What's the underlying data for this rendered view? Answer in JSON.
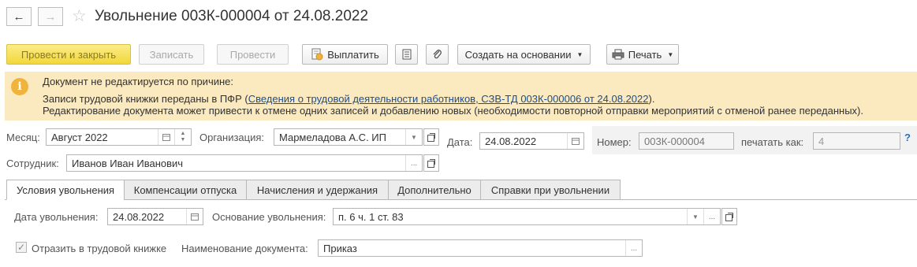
{
  "window": {
    "title": "Увольнение 003К-000004 от 24.08.2022",
    "back_glyph": "←",
    "forward_glyph": "→",
    "star_glyph": "☆"
  },
  "toolbar": {
    "post_close": "Провести и закрыть",
    "save": "Записать",
    "post": "Провести",
    "pay": "Выплатить",
    "create_basis": "Создать на основании",
    "print": "Печать",
    "caret": "▼"
  },
  "banner": {
    "icon_glyph": "i",
    "line1": "Документ не редактируется по причине:",
    "line2_prefix": "Записи трудовой книжки переданы в ПФР (",
    "line2_link": "Сведения о трудовой деятельности работников, СЗВ-ТД 003К-000006 от 24.08.2022",
    "line2_suffix": ").",
    "line3": "Редактирование документа может привести к отмене одних записей и добавлению новых (необходимости повторной отправки мероприятий с отменой ранее переданных).",
    "background": "#fbe9bf"
  },
  "form": {
    "month_label": "Месяц:",
    "month_value": "Август 2022",
    "org_label": "Организация:",
    "org_value": "Мармеладова А.С. ИП",
    "date_label": "Дата:",
    "date_value": "24.08.2022",
    "number_label": "Номер:",
    "number_value": "003К-000004",
    "print_as_label": "печатать как:",
    "print_as_value": "4",
    "help_glyph": "?",
    "employee_label": "Сотрудник:",
    "employee_value": "Иванов Иван Иванович",
    "dots": "..."
  },
  "tabs": [
    {
      "label": "Условия увольнения"
    },
    {
      "label": "Компенсации отпуска"
    },
    {
      "label": "Начисления и удержания"
    },
    {
      "label": "Дополнительно"
    },
    {
      "label": "Справки при увольнении"
    }
  ],
  "dismissal": {
    "date_label": "Дата увольнения:",
    "date_value": "24.08.2022",
    "reason_label": "Основание увольнения:",
    "reason_value": "п. 6 ч. 1 ст. 83",
    "reflect_label": "Отразить в трудовой книжке",
    "reflect_checked": true,
    "doc_name_label": "Наименование документа:",
    "doc_name_value": "Приказ",
    "check_glyph": "✓"
  },
  "colors": {
    "primary_button": "#f2d73a",
    "info_icon": "#f0b43c",
    "link": "#1d4e89",
    "help": "#2f6fb5"
  }
}
